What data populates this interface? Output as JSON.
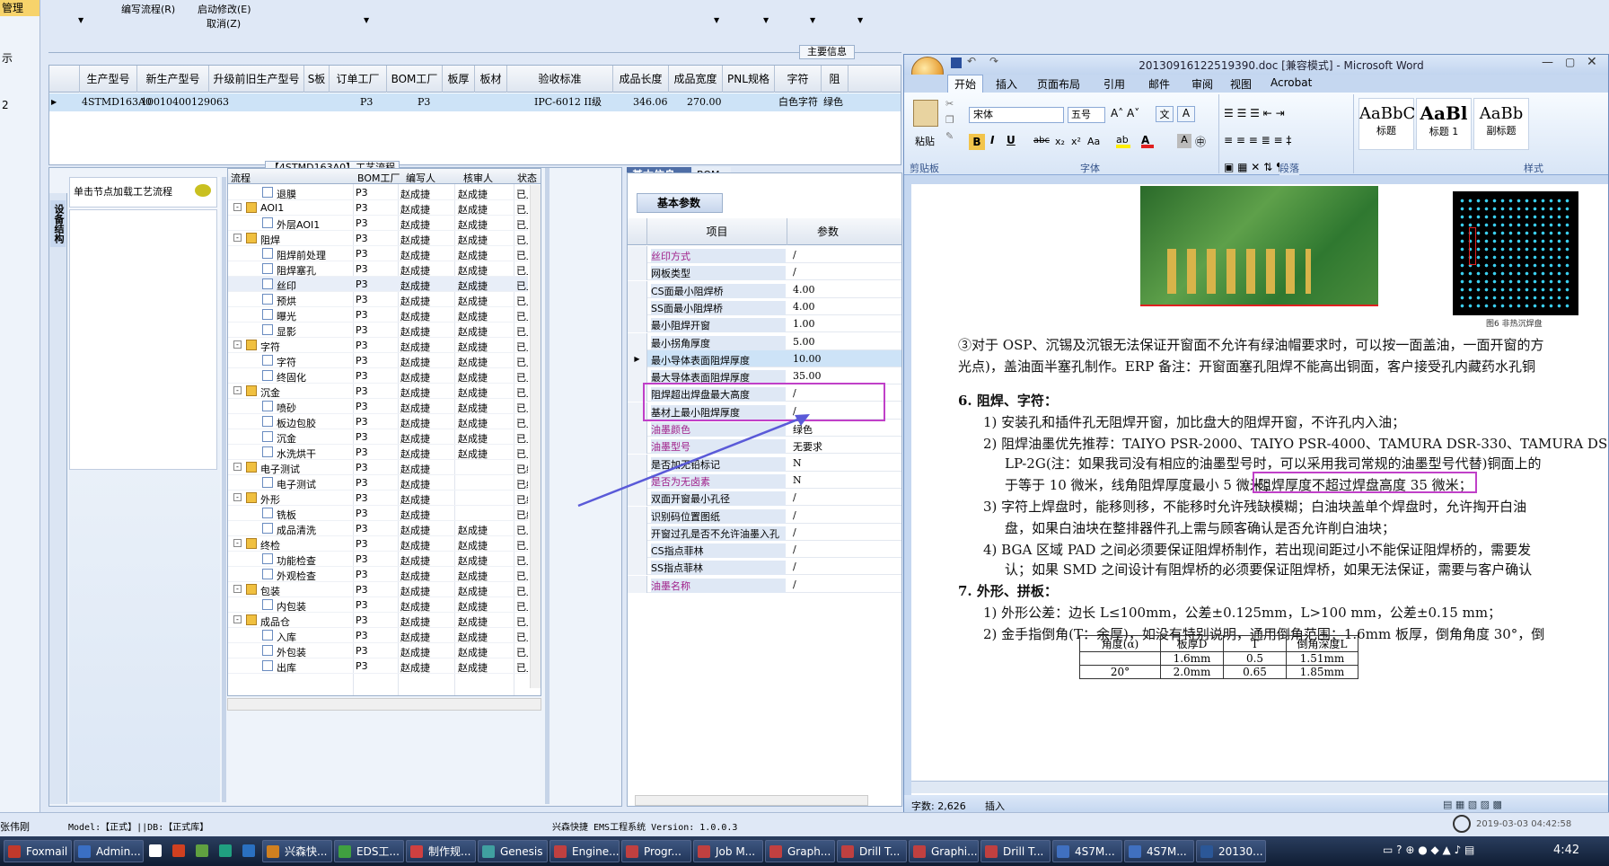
{
  "app": {
    "left_strip": [
      "管理",
      "示",
      "2"
    ],
    "menu": {
      "item1": "编写流程(R)",
      "item2": "启动修改(E)",
      "item3": "取消(Z)"
    },
    "main_info_label": "主要信息"
  },
  "grid": {
    "columns": [
      "生产型号",
      "新生产型号",
      "升级前旧生产型号",
      "S板",
      "订单工厂",
      "BOM工厂",
      "板厚",
      "板材",
      "验收标准",
      "成品长度",
      "成品宽度",
      "PNL规格",
      "字符",
      "阻"
    ],
    "row": [
      "4STMD163A0",
      "10010400129063",
      "",
      "",
      "P3",
      "P3",
      "",
      "",
      "IPC-6012 II级",
      "346.06",
      "270.00",
      "",
      "白色字符",
      "绿色"
    ]
  },
  "process": {
    "title": "【4STMD163A0】工艺流程",
    "side_tab": "设备结构",
    "side_hint": "单击节点加载工艺流程",
    "columns": [
      "流程",
      "BOM工厂",
      "编写人",
      "核审人",
      "状态"
    ],
    "rows": [
      {
        "name": "退膜",
        "level": 2,
        "bom": "P3",
        "writer": "赵成捷",
        "reviewer": "赵成捷",
        "status": "已上R"
      },
      {
        "name": "AOI1",
        "level": 1,
        "bom": "P3",
        "writer": "赵成捷",
        "reviewer": "赵成捷",
        "status": "已上R"
      },
      {
        "name": "外层AOI1",
        "level": 2,
        "bom": "P3",
        "writer": "赵成捷",
        "reviewer": "赵成捷",
        "status": "已上R"
      },
      {
        "name": "阻焊",
        "level": 1,
        "bom": "P3",
        "writer": "赵成捷",
        "reviewer": "赵成捷",
        "status": "已上R"
      },
      {
        "name": "阻焊前处理",
        "level": 2,
        "bom": "P3",
        "writer": "赵成捷",
        "reviewer": "赵成捷",
        "status": "已上R"
      },
      {
        "name": "阻焊塞孔",
        "level": 2,
        "bom": "P3",
        "writer": "赵成捷",
        "reviewer": "赵成捷",
        "status": "已上R"
      },
      {
        "name": "丝印",
        "level": 2,
        "bom": "P3",
        "writer": "赵成捷",
        "reviewer": "赵成捷",
        "status": "已上R"
      },
      {
        "name": "预烘",
        "level": 2,
        "bom": "P3",
        "writer": "赵成捷",
        "reviewer": "赵成捷",
        "status": "已上R"
      },
      {
        "name": "曝光",
        "level": 2,
        "bom": "P3",
        "writer": "赵成捷",
        "reviewer": "赵成捷",
        "status": "已上R"
      },
      {
        "name": "显影",
        "level": 2,
        "bom": "P3",
        "writer": "赵成捷",
        "reviewer": "赵成捷",
        "status": "已上R"
      },
      {
        "name": "字符",
        "level": 1,
        "bom": "P3",
        "writer": "赵成捷",
        "reviewer": "赵成捷",
        "status": "已上R"
      },
      {
        "name": "字符",
        "level": 2,
        "bom": "P3",
        "writer": "赵成捷",
        "reviewer": "赵成捷",
        "status": "已上R"
      },
      {
        "name": "终固化",
        "level": 2,
        "bom": "P3",
        "writer": "赵成捷",
        "reviewer": "赵成捷",
        "status": "已上R"
      },
      {
        "name": "沉金",
        "level": 1,
        "bom": "P3",
        "writer": "赵成捷",
        "reviewer": "赵成捷",
        "status": "已上R"
      },
      {
        "name": "喷砂",
        "level": 2,
        "bom": "P3",
        "writer": "赵成捷",
        "reviewer": "赵成捷",
        "status": "已上R"
      },
      {
        "name": "板边包胶",
        "level": 2,
        "bom": "P3",
        "writer": "赵成捷",
        "reviewer": "赵成捷",
        "status": "已上R"
      },
      {
        "name": "沉金",
        "level": 2,
        "bom": "P3",
        "writer": "赵成捷",
        "reviewer": "赵成捷",
        "status": "已上R"
      },
      {
        "name": "水洗烘干",
        "level": 2,
        "bom": "P3",
        "writer": "赵成捷",
        "reviewer": "赵成捷",
        "status": "已上R"
      },
      {
        "name": "电子测试",
        "level": 1,
        "bom": "P3",
        "writer": "赵成捷",
        "reviewer": "",
        "status": "已编写"
      },
      {
        "name": "电子测试",
        "level": 2,
        "bom": "P3",
        "writer": "赵成捷",
        "reviewer": "",
        "status": "已编写"
      },
      {
        "name": "外形",
        "level": 1,
        "bom": "P3",
        "writer": "赵成捷",
        "reviewer": "",
        "status": "已编写"
      },
      {
        "name": "铣板",
        "level": 2,
        "bom": "P3",
        "writer": "赵成捷",
        "reviewer": "",
        "status": "已编写"
      },
      {
        "name": "成品清洗",
        "level": 2,
        "bom": "P3",
        "writer": "赵成捷",
        "reviewer": "赵成捷",
        "status": "已上R"
      },
      {
        "name": "终检",
        "level": 1,
        "bom": "P3",
        "writer": "赵成捷",
        "reviewer": "赵成捷",
        "status": "已上R"
      },
      {
        "name": "功能检查",
        "level": 2,
        "bom": "P3",
        "writer": "赵成捷",
        "reviewer": "赵成捷",
        "status": "已上R"
      },
      {
        "name": "外观检查",
        "level": 2,
        "bom": "P3",
        "writer": "赵成捷",
        "reviewer": "赵成捷",
        "status": "已上R"
      },
      {
        "name": "包装",
        "level": 1,
        "bom": "P3",
        "writer": "赵成捷",
        "reviewer": "赵成捷",
        "status": "已上R"
      },
      {
        "name": "内包装",
        "level": 2,
        "bom": "P3",
        "writer": "赵成捷",
        "reviewer": "赵成捷",
        "status": "已上R"
      },
      {
        "name": "成品仓",
        "level": 1,
        "bom": "P3",
        "writer": "赵成捷",
        "reviewer": "赵成捷",
        "status": "已上R"
      },
      {
        "name": "入库",
        "level": 2,
        "bom": "P3",
        "writer": "赵成捷",
        "reviewer": "赵成捷",
        "status": "已上R"
      },
      {
        "name": "外包装",
        "level": 2,
        "bom": "P3",
        "writer": "赵成捷",
        "reviewer": "赵成捷",
        "status": "已上R"
      },
      {
        "name": "出库",
        "level": 2,
        "bom": "P3",
        "writer": "赵成捷",
        "reviewer": "赵成捷",
        "status": "已上R"
      }
    ]
  },
  "params": {
    "tab1": "基本信息",
    "tab2": "BOM",
    "subtab": "基本参数",
    "col1": "项目",
    "col2": "参数",
    "rows": [
      {
        "name": "丝印方式",
        "value": "/",
        "pink": true
      },
      {
        "name": "网板类型",
        "value": "/",
        "pink": false
      },
      {
        "name": "CS面最小阻焊桥",
        "value": "4.00",
        "pink": false
      },
      {
        "name": "SS面最小阻焊桥",
        "value": "4.00",
        "pink": false
      },
      {
        "name": "最小阻焊开窗",
        "value": "1.00",
        "pink": false
      },
      {
        "name": "最小拐角厚度",
        "value": "5.00",
        "pink": false
      },
      {
        "name": "最小导体表面阻焊厚度",
        "value": "10.00",
        "pink": false
      },
      {
        "name": "最大导体表面阻焊厚度",
        "value": "35.00",
        "pink": false
      },
      {
        "name": "阻焊超出焊盘最大高度",
        "value": "/",
        "pink": false
      },
      {
        "name": "基材上最小阻焊厚度",
        "value": "/",
        "pink": false
      },
      {
        "name": "油墨颜色",
        "value": "绿色",
        "pink": true
      },
      {
        "name": "油墨型号",
        "value": "无要求",
        "pink": true
      },
      {
        "name": "是否加无铅标记",
        "value": "N",
        "pink": false
      },
      {
        "name": "是否为无卤素",
        "value": "N",
        "pink": true
      },
      {
        "name": "双面开窗最小孔径",
        "value": "/",
        "pink": false
      },
      {
        "name": "识别码位置图纸",
        "value": "/",
        "pink": false
      },
      {
        "name": "开窗过孔是否不允许油墨入孔",
        "value": "/",
        "pink": false
      },
      {
        "name": "CS指点菲林",
        "value": "/",
        "pink": false
      },
      {
        "name": "SS指点菲林",
        "value": "/",
        "pink": false
      },
      {
        "name": "油墨名称",
        "value": "/",
        "pink": true
      }
    ]
  },
  "word": {
    "title": "20130916122519390.doc [兼容模式] - Microsoft Word",
    "tabs": [
      "开始",
      "插入",
      "页面布局",
      "引用",
      "邮件",
      "审阅",
      "视图",
      "Acrobat"
    ],
    "font_name": "宋体",
    "font_size": "五号",
    "paste": "粘贴",
    "groups": {
      "clipboard": "剪贴板",
      "font": "字体",
      "paragraph": "段落",
      "styles": "样式"
    },
    "styles": [
      {
        "sample": "AaBbC",
        "name": "标题"
      },
      {
        "sample": "AaBl",
        "name": "标题 1"
      },
      {
        "sample": "AaBb",
        "name": "副标题"
      }
    ],
    "fig_caption": "图6 非热沉焊盘",
    "doc_lines": [
      "③对于 OSP、沉锡及沉银无法保证开窗面不允许有绿油帽要求时，可以按一面盖油，一面开窗的方",
      "光点)，盖油面半塞孔制作。ERP 备注：开窗面塞孔阻焊不能高出铜面，客户接受孔内藏药水孔铜",
      "6.   阻焊、字符：",
      "1) 安装孔和插件孔无阻焊开窗，加比盘大的阻焊开窗，不许孔内入油；",
      "2) 阻焊油墨优先推荐：TAIYO PSR-2000、TAIYO PSR-4000、TAMURA  DSR-330、TAMURA DS",
      "LP-2G(注：如果我司没有相应的油墨型号时，可以采用我司常规的油墨型号代替)铜面上的",
      "于等于 10 微米，线角阻焊厚度最小 5 微米；",
      "阻焊厚度不超过焊盘高度 35 微米；",
      "3) 字符上焊盘时，能移则移，不能移时允许残缺模糊；白油块盖单个焊盘时，允许掏开白油",
      "盘，如果白油块在整排器件孔上需与顾客确认是否允许削白油块；",
      "4) BGA 区域 PAD 之间必须要保证阻焊桥制作，若出现间距过小不能保证阻焊桥的，需要发",
      "认；如果 SMD 之间设计有阻焊桥的必须要保证阻焊桥，如果无法保证，需要与客户确认",
      "7.   外形、拼板：",
      "1) 外形公差：边长 L≤100mm，公差±0.125mm，L>100 mm，公差±0.15 mm；",
      "2) 金手指倒角(T：余厚)，如没有特别说明，通用倒角范围：1.6mm 板厚，倒角角度 30°，倒"
    ],
    "table": {
      "headers": [
        "角度(α)",
        "板厚D",
        "T",
        "倒角深度L"
      ],
      "rows": [
        [
          "",
          "1.6mm",
          "0.5",
          "1.51mm"
        ],
        [
          "20°",
          "2.0mm",
          "0.65",
          "1.85mm"
        ]
      ]
    },
    "status_words": "字数: 2,626",
    "status_insert": "插入"
  },
  "statusbar": {
    "user": "张伟刚",
    "model": "Model:【正式】||DB:【正式库】",
    "system": "兴森快捷 EMS工程系统 Version: 1.0.0.3",
    "datetime": "2019-03-03 04:42:58"
  },
  "taskbar": {
    "items": [
      {
        "label": "Foxmail",
        "color": "#c0392b"
      },
      {
        "label": "Admin...",
        "color": "#3a6fc4"
      },
      {
        "label": "",
        "color": "#ffffff"
      },
      {
        "label": "",
        "color": "#d04020"
      },
      {
        "label": "",
        "color": "#60a040"
      },
      {
        "label": "",
        "color": "#20a080"
      },
      {
        "label": "",
        "color": "#2a70c0"
      },
      {
        "label": "兴森快...",
        "color": "#d08020"
      },
      {
        "label": "EDS工...",
        "color": "#40a040"
      },
      {
        "label": "制作规...",
        "color": "#d04040"
      },
      {
        "label": "Genesis",
        "color": "#40a0a0"
      },
      {
        "label": "Engine...",
        "color": "#c04040"
      },
      {
        "label": "Progr...",
        "color": "#c04040"
      },
      {
        "label": "Job M...",
        "color": "#c04040"
      },
      {
        "label": "Graph...",
        "color": "#c04040"
      },
      {
        "label": "Drill T...",
        "color": "#c04040"
      },
      {
        "label": "Graphi...",
        "color": "#c04040"
      },
      {
        "label": "Drill T...",
        "color": "#c04040"
      },
      {
        "label": "4S7M...",
        "color": "#4070c0"
      },
      {
        "label": "4S7M...",
        "color": "#4070c0"
      },
      {
        "label": "20130...",
        "color": "#2b5797"
      }
    ],
    "clock": "4:42"
  }
}
